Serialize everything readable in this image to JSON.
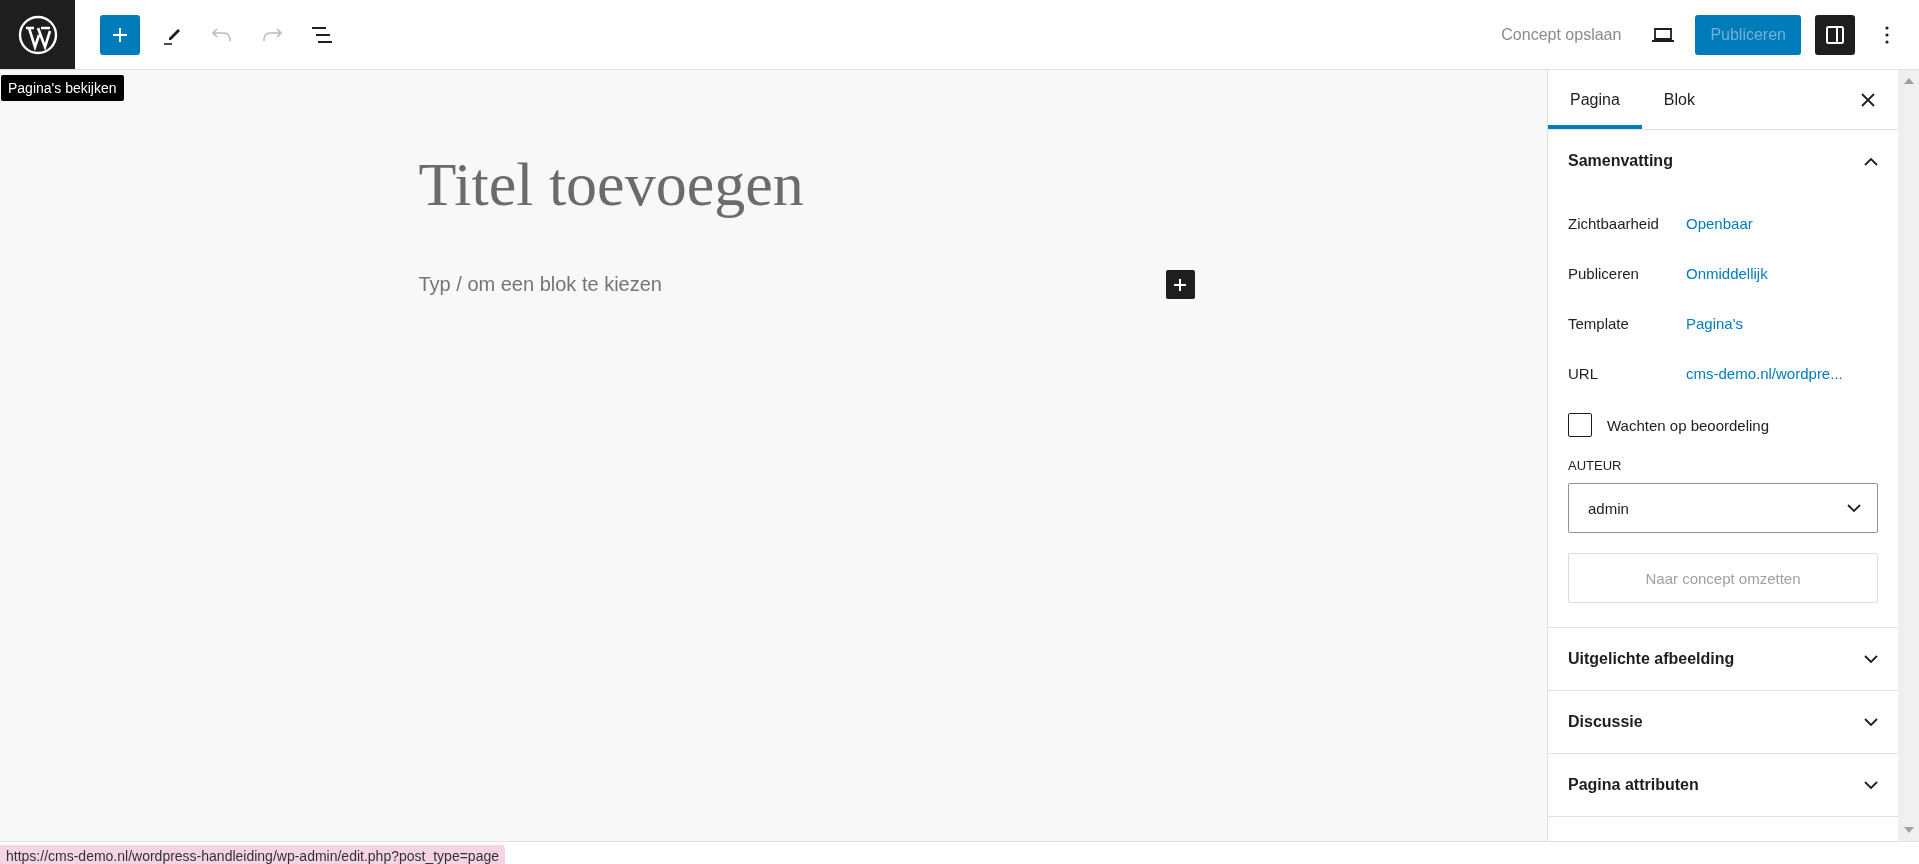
{
  "header": {
    "tools": [
      {
        "kind": "inserter",
        "disabled": false
      },
      {
        "kind": "edit",
        "disabled": false
      },
      {
        "kind": "undo",
        "disabled": true
      },
      {
        "kind": "redo",
        "disabled": true
      },
      {
        "kind": "outline",
        "disabled": false
      }
    ],
    "save_draft": "Concept opslaan",
    "publish": {
      "label": "Publiceren",
      "disabled": true
    },
    "settings_toggle": {
      "pressed": true
    }
  },
  "tooltip": "Pagina's bekijken",
  "editor": {
    "title_placeholder": "Titel toevoegen",
    "block_placeholder": "Typ / om een blok te kiezen"
  },
  "sidebar": {
    "tabs": [
      {
        "label": "Pagina",
        "selected": true
      },
      {
        "label": "Blok",
        "selected": false
      }
    ],
    "sections": [
      {
        "title": "Samenvatting",
        "expanded": true,
        "rows": [
          {
            "label": "Zichtbaarheid",
            "value": "Openbaar"
          },
          {
            "label": "Publiceren",
            "value": "Onmiddellijk"
          },
          {
            "label": "Template",
            "value": "Pagina's"
          },
          {
            "label": "URL",
            "value": "cms-demo.nl/wordpre..."
          }
        ],
        "pending_review": {
          "label": "Wachten op beoordeling",
          "checked": false
        },
        "author": {
          "label": "AUTEUR",
          "value": "admin"
        },
        "revert_button": {
          "label": "Naar concept omzetten",
          "disabled": true
        }
      },
      {
        "title": "Uitgelichte afbeelding",
        "expanded": false
      },
      {
        "title": "Discussie",
        "expanded": false
      },
      {
        "title": "Pagina attributen",
        "expanded": false
      }
    ]
  },
  "status_url": "https://cms-demo.nl/wordpress-handleiding/wp-admin/edit.php?post_type=page"
}
